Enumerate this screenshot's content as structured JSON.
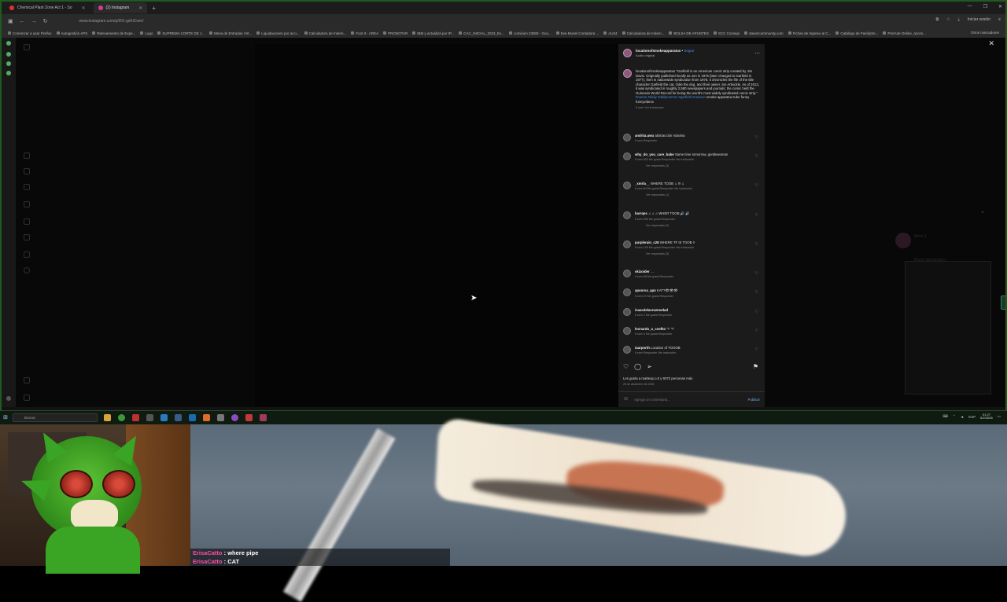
{
  "browser": {
    "tabs": [
      {
        "label": "Chemical Plant Zone Act 1 - So",
        "color": "#e03030",
        "active": false
      },
      {
        "label": "(2) Instagram",
        "color": "#d0408a",
        "active": true
      }
    ],
    "url": "www.instagram.com/p/DG-gsKiCwm/",
    "session_label": "Iniciar sesión",
    "bookmarks": [
      "Comenzar a usar Firefox",
      "Autogestión APS",
      "Relevamiento de Expe...",
      "Logo",
      "SUPREMA CORTE DE J...",
      "Mesa de Entradas Virt...",
      "Liquidaciones por acci...",
      "Calculadora de Indem...",
      "Font It - AREA",
      "PRONOTAR",
      "IBM y actualizá por IP...",
      "CAC_INICIAL_2023_Ex...",
      "comision 23000 - Goo...",
      "Eve Muriel Contadora ...",
      "AU24",
      "Calculadora de Indem...",
      "BOLSA DE APUNTES",
      "SCC Consejo",
      "steamcommunity.com",
      "Fichas de Ingreso al C...",
      "Catálogo de FamilySe...",
      "Prerrute Online, acces..."
    ],
    "other_bookmarks": "Otros marcadores"
  },
  "post": {
    "username": "locationofsmokeapparatus",
    "follow": "Seguir",
    "audio": "Audio original",
    "caption": "locationofsmokeapparatus \"Garfield is an American comic strip created by Jim Davis. Originally published locally as Jon in 1976 (later changed to Garfield in 1977), then in nationwide syndication from 1978, it chronicles the life of the title character Garfield the cat, Odie the dog, and their owner Jon Arbuckle. As of 2013, it was syndicated in roughly 2,580 newspapers and journals; the comic held the Guinness World Record for being the world's most widely syndicated comic strip.\"",
    "hashtags": "#meme #daily #dailymemes #garfield #cartoon",
    "caption_tail": " smoke apparatus tube funny funnyvideos",
    "caption_meta": "9 sem    Ver traducción",
    "comments": [
      {
        "user": "andrita.uwu",
        "text": "abstracción máxima",
        "meta": "9 sem    Responder",
        "replies": ""
      },
      {
        "user": "why_do_you_care_babe",
        "text": "Same time tomorrow, gentlewoman",
        "meta": "6 sem    520 Me gusta    Responder    Ver traducción",
        "replies": "Ver respuestas (3)"
      },
      {
        "user": "_xmrla__",
        "text": "WHERE TOOB ♫ !!! ♫",
        "meta": "6 sem    64 Me gusta    Responder    Ver traducción",
        "replies": "Ver respuestas (1)"
      },
      {
        "user": "barrqes",
        "text": "♫ ♫ ♫ WHER TOOB 🔊 🔊",
        "meta": "6 sem    998 Me gusta    Responder",
        "replies": "Ver respuestas (2)"
      },
      {
        "user": "purplerain_c28",
        "text": "WHERE TF IS TOOB ‼",
        "meta": "6 sem    109 Me gusta    Responder    Ver traducción",
        "replies": "Ver respuestas (3)"
      },
      {
        "user": "skizoider",
        "text": "…",
        "meta": "6 sem    68 Me gusta    Responder",
        "replies": ""
      },
      {
        "user": "apoorva_apn",
        "text": "KAT?👁👁👁",
        "meta": "6 sem    23 Me gusta    Responder",
        "replies": ""
      },
      {
        "user": "isaacdelacruzmedad",
        "text": "",
        "meta": "6 sem    2 Me gusta    Responder",
        "replies": ""
      },
      {
        "user": "leonardo_a_coelho",
        "text": "\"!\" \"!\"",
        "meta": "6 sem    4 Me gusta    Responder",
        "replies": ""
      },
      {
        "user": "taarporth",
        "text": "Location of TOOOB",
        "meta": "6 sem    Responder    Ver traducción",
        "replies": ""
      }
    ],
    "likes": "Les gusta a matteop.o.0 y 9372 personas más",
    "date": "26 de diciembre de 2025",
    "comment_placeholder": "Agrega un comentario...",
    "publish": "Publicar"
  },
  "ghost_window": {
    "name": "Mern-1",
    "title": "Marta Sanderland"
  },
  "taskbar": {
    "search_placeholder": "Buscar",
    "tray": [
      "ESP"
    ],
    "time": "01:27",
    "date": "6/2/2026"
  },
  "chat": [
    {
      "user": "ErisaCatto",
      "message": "where pipe"
    },
    {
      "user": "ErisaCatto",
      "message": "CAT"
    }
  ]
}
